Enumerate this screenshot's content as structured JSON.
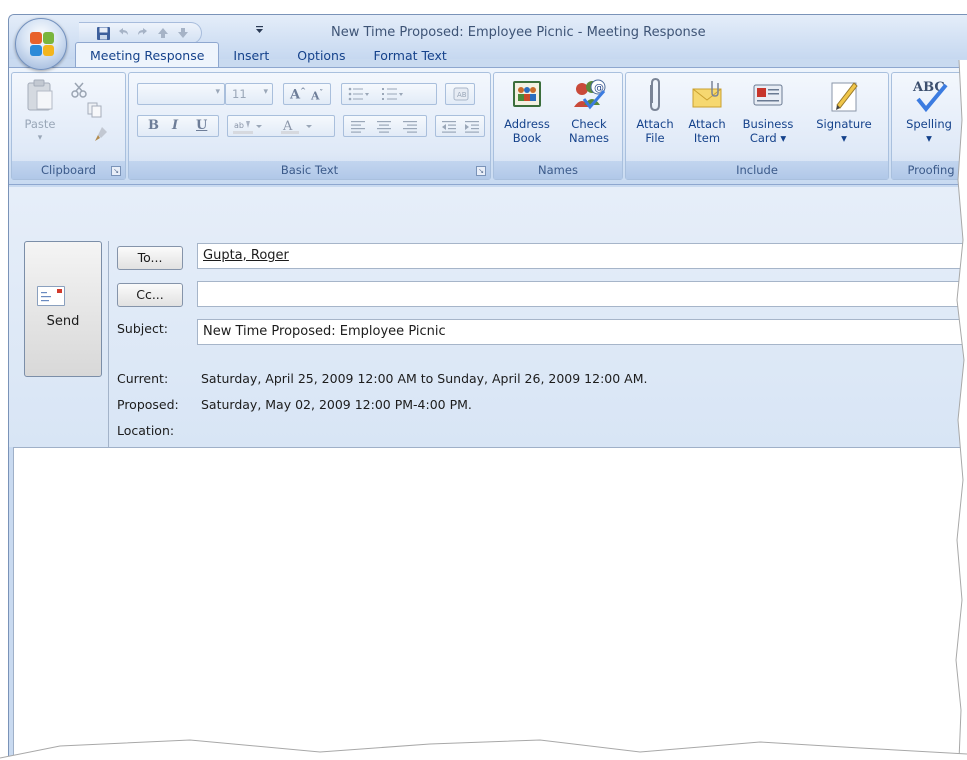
{
  "window": {
    "title": "New Time Proposed: Employee Picnic - Meeting Response"
  },
  "quick_access": {
    "icons": [
      "save-icon",
      "undo-icon",
      "redo-icon",
      "previous-item-icon",
      "next-item-icon",
      "customize-dropdown-icon"
    ]
  },
  "tabs": [
    {
      "label": "Meeting Response",
      "active": true
    },
    {
      "label": "Insert",
      "active": false
    },
    {
      "label": "Options",
      "active": false
    },
    {
      "label": "Format Text",
      "active": false
    }
  ],
  "ribbon": {
    "clipboard": {
      "group_label": "Clipboard",
      "paste_label": "Paste"
    },
    "basic_text": {
      "group_label": "Basic Text",
      "font_size": "11"
    },
    "names": {
      "group_label": "Names",
      "address_book_label1": "Address",
      "address_book_label2": "Book",
      "check_names_label1": "Check",
      "check_names_label2": "Names"
    },
    "include": {
      "group_label": "Include",
      "attach_file_label1": "Attach",
      "attach_file_label2": "File",
      "attach_item_label1": "Attach",
      "attach_item_label2": "Item",
      "business_card_label1": "Business",
      "business_card_label2": "Card ▾",
      "signature_label1": "Signature",
      "signature_label2": "▾"
    },
    "proofing": {
      "group_label": "Proofing",
      "spelling_label1": "Spelling",
      "spelling_label2": "▾",
      "abc_text": "ABC"
    }
  },
  "form": {
    "send_label": "Send",
    "to_button": "To...",
    "cc_button": "Cc...",
    "to_value": "Gupta, Roger",
    "cc_value": "",
    "subject_label": "Subject:",
    "subject_value": "New Time Proposed: Employee Picnic",
    "current_label": "Current:",
    "current_value": "Saturday, April 25, 2009 12:00 AM to Sunday, April 26, 2009 12:00 AM.",
    "proposed_label": "Proposed:",
    "proposed_value": "Saturday, May 02, 2009 12:00 PM-4:00 PM.",
    "location_label": "Location:",
    "location_value": ""
  },
  "colors": {
    "ribbon_text": "#15428b",
    "window_bg": "#c9daf0"
  }
}
